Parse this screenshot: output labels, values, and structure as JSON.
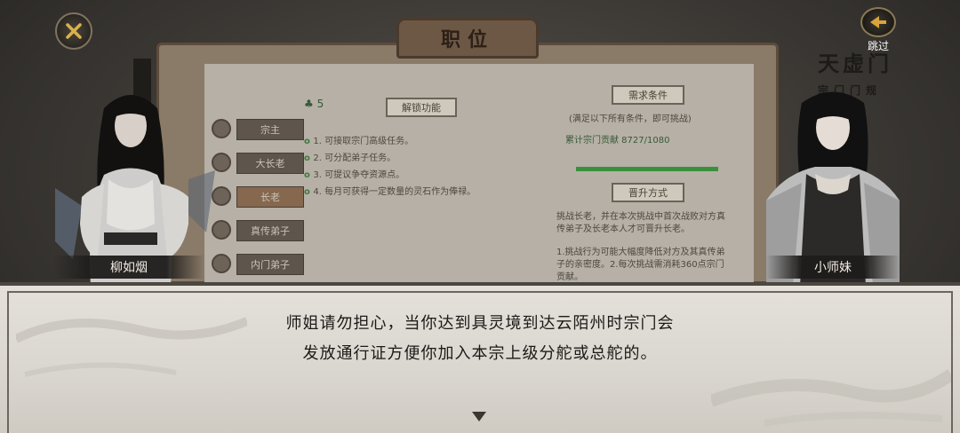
{
  "top": {
    "skip_label": "跳过"
  },
  "panel": {
    "title": "职位",
    "rank_icons_count": "5",
    "ranks": [
      {
        "label": "宗主",
        "selected": false
      },
      {
        "label": "大长老",
        "selected": false
      },
      {
        "label": "长老",
        "selected": true
      },
      {
        "label": "真传弟子",
        "selected": false
      },
      {
        "label": "内门弟子",
        "selected": false
      }
    ],
    "unlock_label": "解锁功能",
    "perks": [
      "1. 可接取宗门高级任务。",
      "2. 可分配弟子任务。",
      "3. 可提议争夺资源点。",
      "4. 每月可获得一定数量的灵石作为俸禄。"
    ],
    "requirements_label": "需求条件",
    "requirements_note": "(满足以下所有条件，即可挑战)",
    "requirement_item": "累计宗门贡献 8727/1080",
    "requirement_progress": 1.0,
    "promotion_label": "晋升方式",
    "promotion_text": "挑战长老，并在本次挑战中首次战败对方真传弟子及长老本人才可晋升长老。",
    "promotion_rules": "1.挑战行为可能大幅度降低对方及其真传弟子的亲密度。2.每次挑战需消耗360点宗门贡献。"
  },
  "sign": {
    "main": "天虚门",
    "sub": "宗门门规"
  },
  "characters": {
    "left_name": "柳如烟",
    "right_name": "小师妹"
  },
  "dialogue": {
    "line1": "师姐请勿担心，当你达到具灵境到达云陌州时宗门会",
    "line2": "发放通行证方便你加入本宗上级分舵或总舵的。"
  },
  "colors": {
    "dialog_bg": "#e4e1db",
    "panel_frame": "#8a7a68",
    "accent_green": "#3b8f3b"
  }
}
